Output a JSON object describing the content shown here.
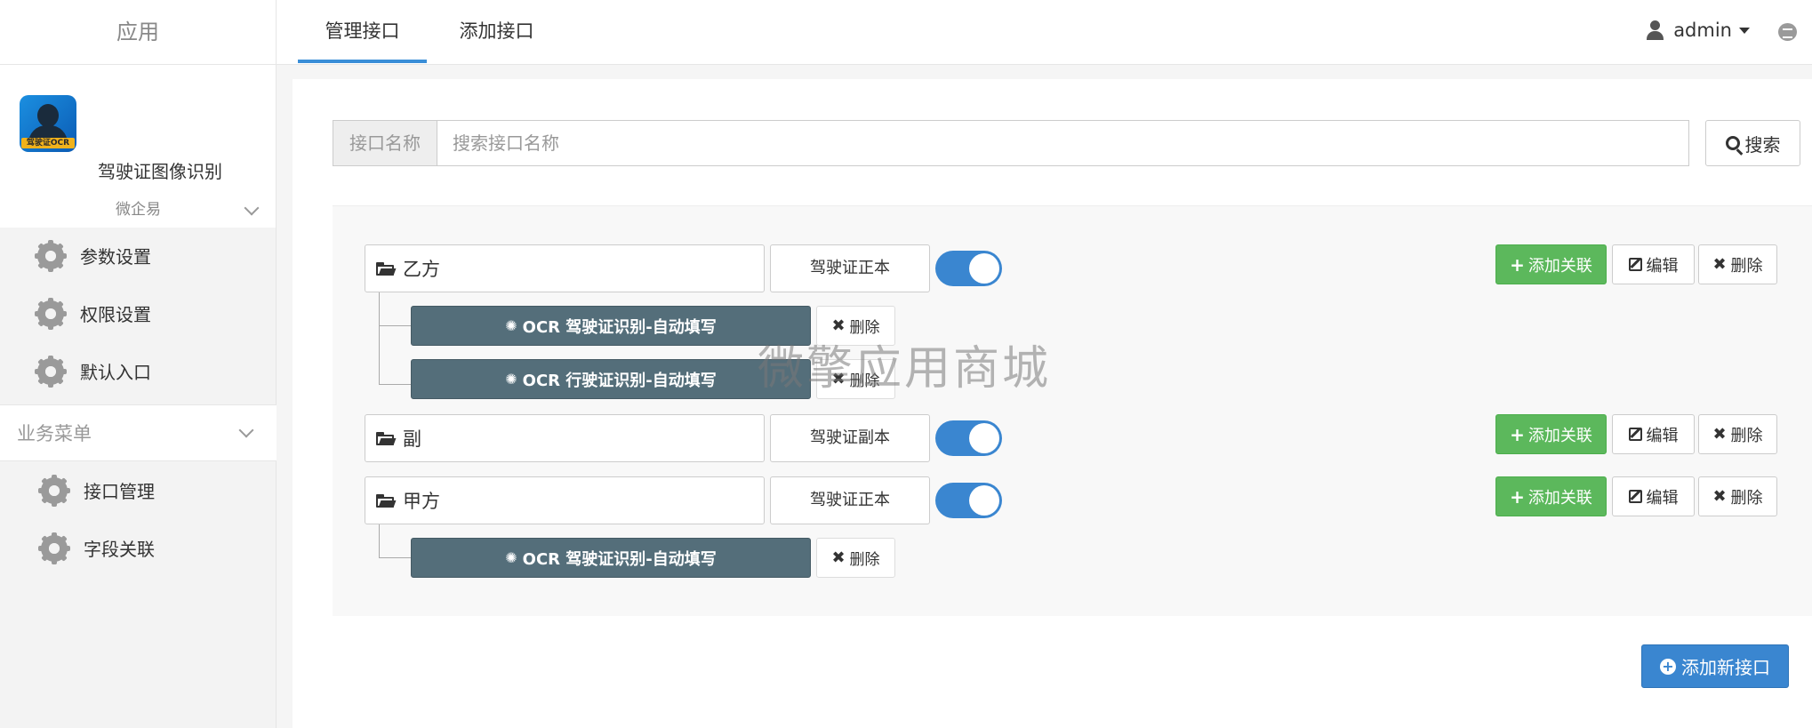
{
  "sidebar": {
    "header": "应用",
    "app_name": "驾驶证图像识别",
    "app_logo_tag": "驾驶证OCR",
    "platform": "微企易",
    "items_top": [
      {
        "label": "参数设置"
      },
      {
        "label": "权限设置"
      },
      {
        "label": "默认入口"
      }
    ],
    "section_title": "业务菜单",
    "items_business": [
      {
        "label": "接口管理"
      },
      {
        "label": "字段关联"
      }
    ]
  },
  "topbar": {
    "tabs": [
      {
        "label": "管理接口",
        "active": true
      },
      {
        "label": "添加接口",
        "active": false
      }
    ],
    "user": "admin"
  },
  "search": {
    "addon": "接口名称",
    "placeholder": "搜索接口名称",
    "value": "",
    "button": "搜索"
  },
  "interfaces": [
    {
      "name": "乙方",
      "type": "驾驶证正本",
      "enabled": true,
      "children": [
        {
          "label": "OCR 驾驶证识别-自动填写",
          "delete": "删除"
        },
        {
          "label": "OCR 行驶证识别-自动填写",
          "delete": "删除"
        }
      ]
    },
    {
      "name": "副",
      "type": "驾驶证副本",
      "enabled": true,
      "children": []
    },
    {
      "name": "甲方",
      "type": "驾驶证正本",
      "enabled": true,
      "children": [
        {
          "label": "OCR 驾驶证识别-自动填写",
          "delete": "删除"
        }
      ]
    }
  ],
  "actions": {
    "add_relation": "添加关联",
    "edit": "编辑",
    "delete": "删除",
    "add_new": "添加新接口"
  },
  "watermark": "微擎应用商城",
  "colors": {
    "accent": "#3a86d0",
    "success": "#5cb85c",
    "child_bg": "#546e7a"
  },
  "icons": {
    "folder": "folder-open-icon",
    "gear": "gear-icon",
    "search": "search-icon",
    "user": "user-icon",
    "chat": "chat-icon"
  }
}
